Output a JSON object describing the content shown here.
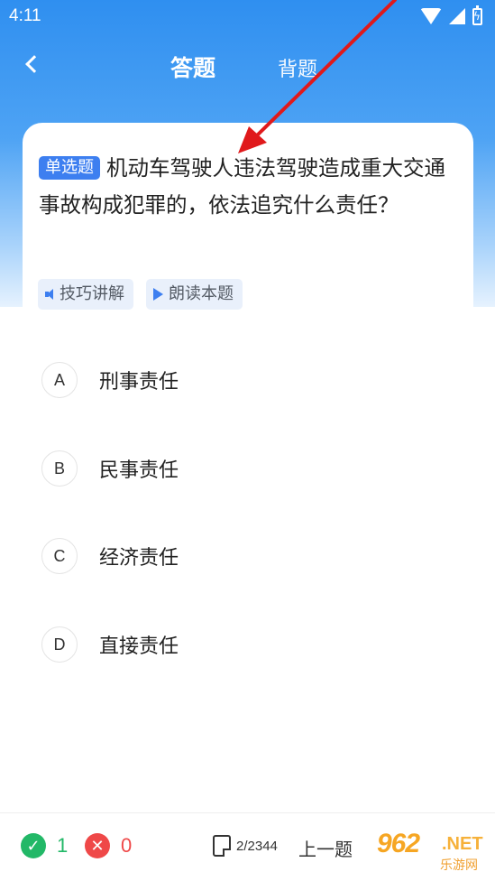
{
  "status_bar": {
    "time": "4:11"
  },
  "header": {
    "tabs": [
      {
        "label": "答题",
        "active": true
      },
      {
        "label": "背题",
        "active": false
      }
    ]
  },
  "question": {
    "type_badge": "单选题",
    "text": "机动车驾驶人违法驾驶造成重大交通事故构成犯罪的，依法追究什么责任？",
    "tools": [
      {
        "label": "技巧讲解",
        "icon": "speaker-icon"
      },
      {
        "label": "朗读本题",
        "icon": "play-icon"
      }
    ]
  },
  "options": [
    {
      "letter": "A",
      "text": "刑事责任"
    },
    {
      "letter": "B",
      "text": "民事责任"
    },
    {
      "letter": "C",
      "text": "经济责任"
    },
    {
      "letter": "D",
      "text": "直接责任"
    }
  ],
  "bottom_bar": {
    "correct_count": "1",
    "wrong_count": "0",
    "progress": "2/2344",
    "prev_label": "上一题"
  },
  "watermark": {
    "digits": "962",
    "net": ".NET",
    "cn": "乐游网"
  },
  "colors": {
    "header_blue": "#2f8ff0",
    "badge_blue": "#3d7ff0",
    "correct_green": "#22b867",
    "wrong_red": "#ef4848",
    "annotation_arrow": "#e0191b"
  }
}
